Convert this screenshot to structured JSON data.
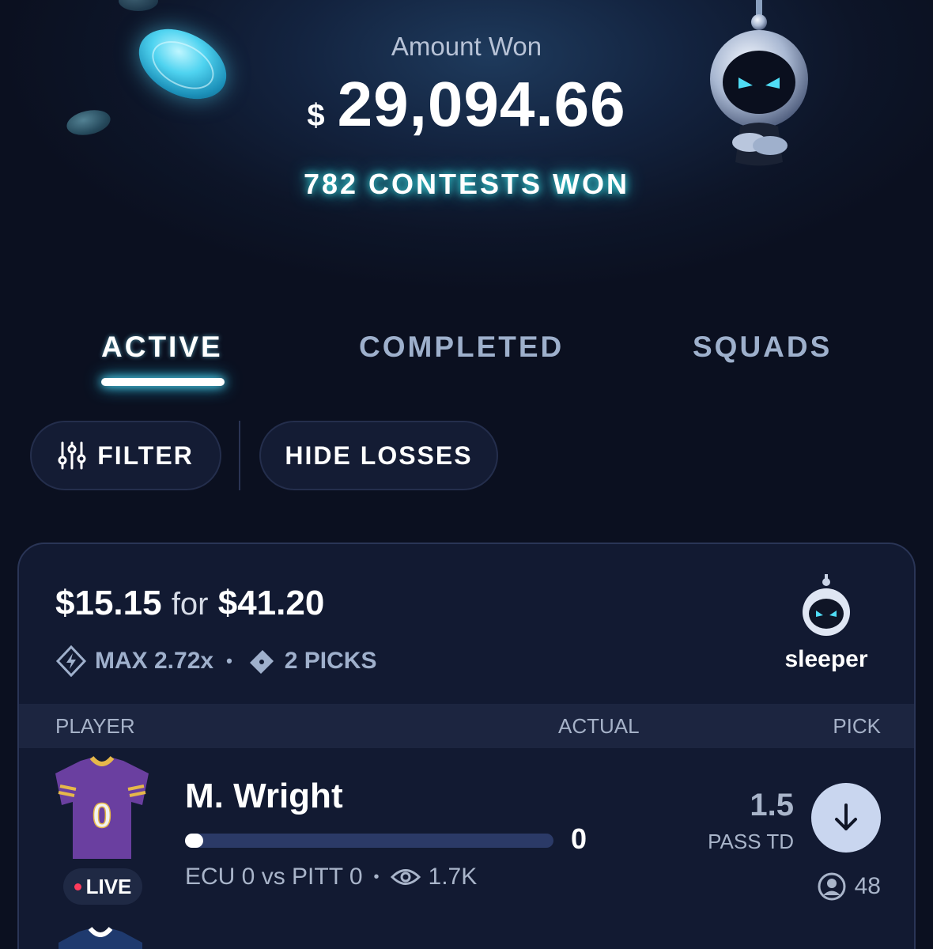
{
  "hero": {
    "label": "Amount Won",
    "currency": "$",
    "amount": "29,094.66",
    "contests_won": "782 CONTESTS WON"
  },
  "tabs": [
    {
      "label": "ACTIVE",
      "active": true
    },
    {
      "label": "COMPLETED",
      "active": false
    },
    {
      "label": "SQUADS",
      "active": false
    }
  ],
  "filters": {
    "filter_label": "FILTER",
    "hide_losses_label": "HIDE LOSSES"
  },
  "card": {
    "entry": "$15.15",
    "for_word": "for",
    "payout": "$41.20",
    "max_multiplier": "MAX 2.72x",
    "picks": "2 PICKS",
    "brand": "sleeper",
    "columns": {
      "player": "PLAYER",
      "actual": "ACTUAL",
      "pick": "PICK"
    },
    "rows": [
      {
        "jersey_number": "0",
        "status": "LIVE",
        "player": "M. Wright",
        "actual": "0",
        "progress_fraction": 0.05,
        "game": "ECU 0 vs PITT 0",
        "views": "1.7K",
        "line": "1.5",
        "stat": "PASS TD",
        "pick_direction": "under",
        "pick_count": "48"
      }
    ]
  },
  "colors": {
    "background": "#0b1020",
    "card": "#121a32",
    "accent_glow": "#3de3e6",
    "live_dot": "#ff3b5c",
    "jersey_purple": "#6a3fa0",
    "jersey_gold": "#e6b84a"
  },
  "icons": [
    "sliders-icon",
    "shield-bolt-icon",
    "ticket-icon",
    "sleeper-logo-icon",
    "eye-icon",
    "arrow-down-icon",
    "user-circle-icon"
  ]
}
